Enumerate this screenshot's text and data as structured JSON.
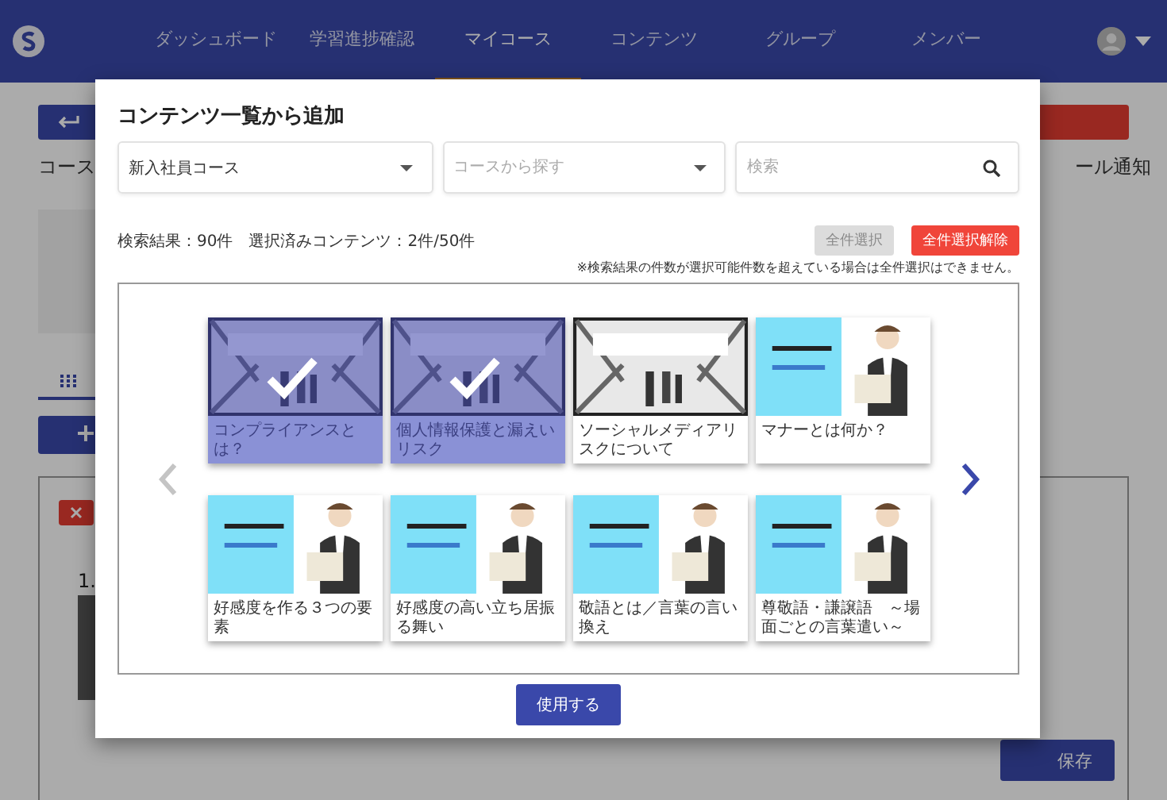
{
  "nav": {
    "items": [
      {
        "label": "ダッシュボード",
        "selected": false
      },
      {
        "label": "学習進捗確認",
        "selected": false
      },
      {
        "label": "マイコース",
        "selected": true
      },
      {
        "label": "コンテンツ",
        "selected": false
      },
      {
        "label": "グループ",
        "selected": false
      },
      {
        "label": "メンバー",
        "selected": false
      }
    ]
  },
  "page": {
    "heading": "コース",
    "notify_label": "ール通知",
    "item_number": "1.",
    "save_button": "保存"
  },
  "modal": {
    "title": "コンテンツ一覧から追加",
    "course_select": {
      "value": "新入社員コース"
    },
    "course_search": {
      "placeholder": "コースから探す"
    },
    "search": {
      "placeholder": "検索"
    },
    "result_summary": "検索結果：90件　選択済みコンテンツ：2件/50件",
    "select_all": {
      "label": "全件選択",
      "disabled": true
    },
    "deselect_all": {
      "label": "全件選択解除",
      "disabled": false
    },
    "note": "※検索結果の件数が選択可能件数を超えている場合は全件選択はできません。",
    "prev": {
      "disabled": true
    },
    "next": {
      "disabled": false
    },
    "cards": [
      {
        "title": "コンプライアンスとは？",
        "selected": true,
        "kind": "photo"
      },
      {
        "title": "個人情報保護と漏えいリスク",
        "selected": true,
        "kind": "photo"
      },
      {
        "title": "ソーシャルメディアリスクについて",
        "selected": false,
        "kind": "photo"
      },
      {
        "title": "マナーとは何か？",
        "selected": false,
        "kind": "banner"
      },
      {
        "title": "好感度を作る３つの要素",
        "selected": false,
        "kind": "banner"
      },
      {
        "title": "好感度の高い立ち居振る舞い",
        "selected": false,
        "kind": "banner"
      },
      {
        "title": "敬語とは／言葉の言い換え",
        "selected": false,
        "kind": "banner"
      },
      {
        "title": "尊敬語・謙譲語　～場面ごとの言葉遣い～",
        "selected": false,
        "kind": "banner"
      }
    ],
    "submit": "使用する"
  }
}
